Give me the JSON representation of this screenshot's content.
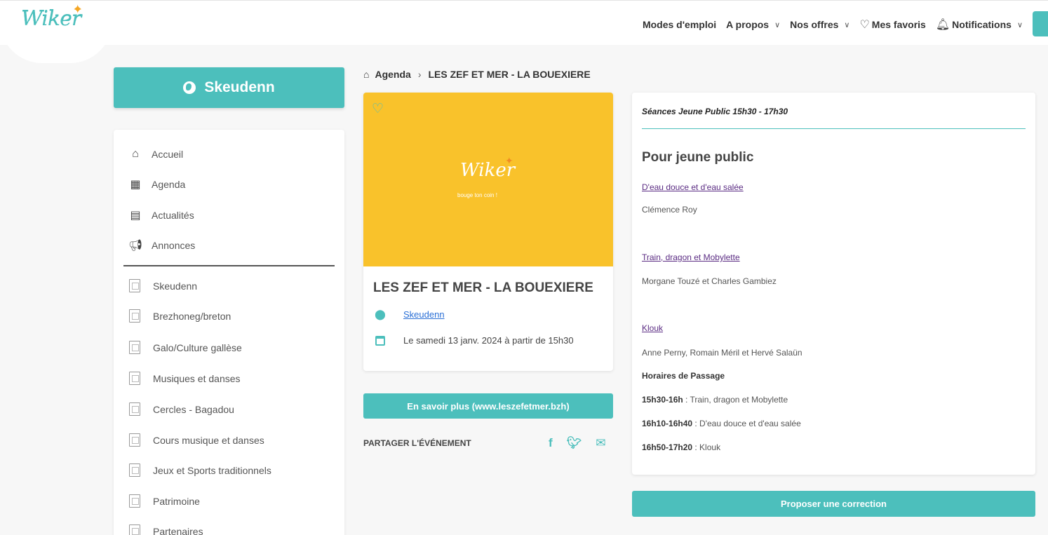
{
  "header": {
    "logo_text": "Wiker",
    "nav": [
      {
        "label": "Modes d'emploi"
      },
      {
        "label": "A propos"
      },
      {
        "label": "Nos offres"
      },
      {
        "label": "Mes favoris"
      },
      {
        "label": "Notifications"
      }
    ]
  },
  "sidebar": {
    "city_button": "Skeudenn",
    "main_items": [
      {
        "label": "Accueil",
        "icon": "home-icon"
      },
      {
        "label": "Agenda",
        "icon": "calendar-icon"
      },
      {
        "label": "Actualités",
        "icon": "news-icon"
      },
      {
        "label": "Annonces",
        "icon": "megaphone-icon"
      }
    ],
    "category_items": [
      {
        "label": "Skeudenn"
      },
      {
        "label": "Brezhoneg/breton"
      },
      {
        "label": "Galo/Culture gallèse"
      },
      {
        "label": "Musiques et danses"
      },
      {
        "label": "Cercles - Bagadou"
      },
      {
        "label": "Cours musique et danses"
      },
      {
        "label": "Jeux et Sports traditionnels"
      },
      {
        "label": "Patrimoine"
      },
      {
        "label": "Partenaires"
      }
    ]
  },
  "breadcrumb": {
    "parent": "Agenda",
    "current": "LES ZEF ET MER - LA BOUEXIERE"
  },
  "event": {
    "image_logo": "Wiker",
    "image_tagline": "bouge ton coin !",
    "title": "LES ZEF ET MER - LA BOUEXIERE",
    "location": "Skeudenn",
    "date": "Le samedi 13 janv. 2024 à partir de 15h30",
    "more_button": "En savoir plus (www.leszefetmer.bzh)",
    "share_label": "PARTAGER L'ÉVÉNEMENT"
  },
  "description": {
    "header": "Séances Jeune Public 15h30 - 17h30",
    "heading": "Pour jeune public",
    "shows": [
      {
        "title": "D'eau douce et d'eau salée",
        "artists": "Clémence Roy"
      },
      {
        "title": "Train, dragon et Mobylette",
        "artists": "Morgane Touzé et Charles Gambiez"
      },
      {
        "title": "Klouk",
        "artists": "Anne Perny, Romain Méril et Hervé Salaün"
      }
    ],
    "schedule_heading": "Horaires de Passage",
    "schedule": [
      {
        "time": "15h30-16h",
        "text": " : Train, dragon et Mobylette"
      },
      {
        "time": "16h10-16h40",
        "text": " : D'eau douce et d'eau salée"
      },
      {
        "time": "16h50-17h20",
        "text": " : Klouk"
      }
    ]
  },
  "correction_button": "Proposer une correction",
  "colors": {
    "accent": "#4cbfbc",
    "event_image": "#f9c22b",
    "link": "#5b2c83"
  }
}
